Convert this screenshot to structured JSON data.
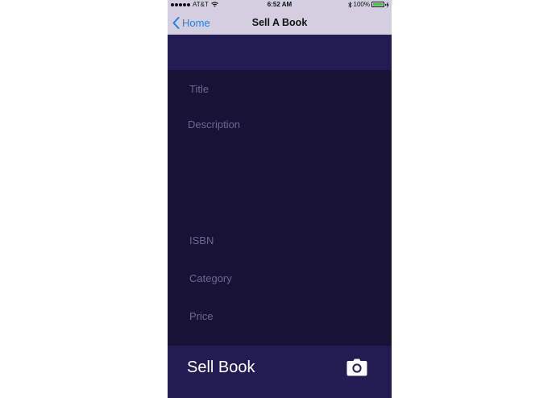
{
  "status_bar": {
    "carrier": "AT&T",
    "time": "6:52 AM",
    "battery": "100%",
    "signal_icon": "signal-dots-icon",
    "wifi_icon": "wifi-icon",
    "bluetooth_icon": "bluetooth-icon",
    "battery_icon": "battery-icon",
    "charging_icon": "charging-icon"
  },
  "nav": {
    "back_label": "Home",
    "back_icon": "chevron-left-icon",
    "title": "Sell A Book"
  },
  "form": {
    "title_placeholder": "Title",
    "description_placeholder": "Description",
    "isbn_placeholder": "ISBN",
    "category_placeholder": "Category",
    "price_placeholder": "Price"
  },
  "footer": {
    "sell_label": "Sell Book",
    "camera_icon": "camera-icon"
  },
  "colors": {
    "nav_background": "#d3cfe0",
    "accent": "#1a82f0",
    "form_background": "#181336",
    "band_background": "#231c52",
    "placeholder_text": "#6e6890",
    "battery_fill": "#3cc93c"
  }
}
